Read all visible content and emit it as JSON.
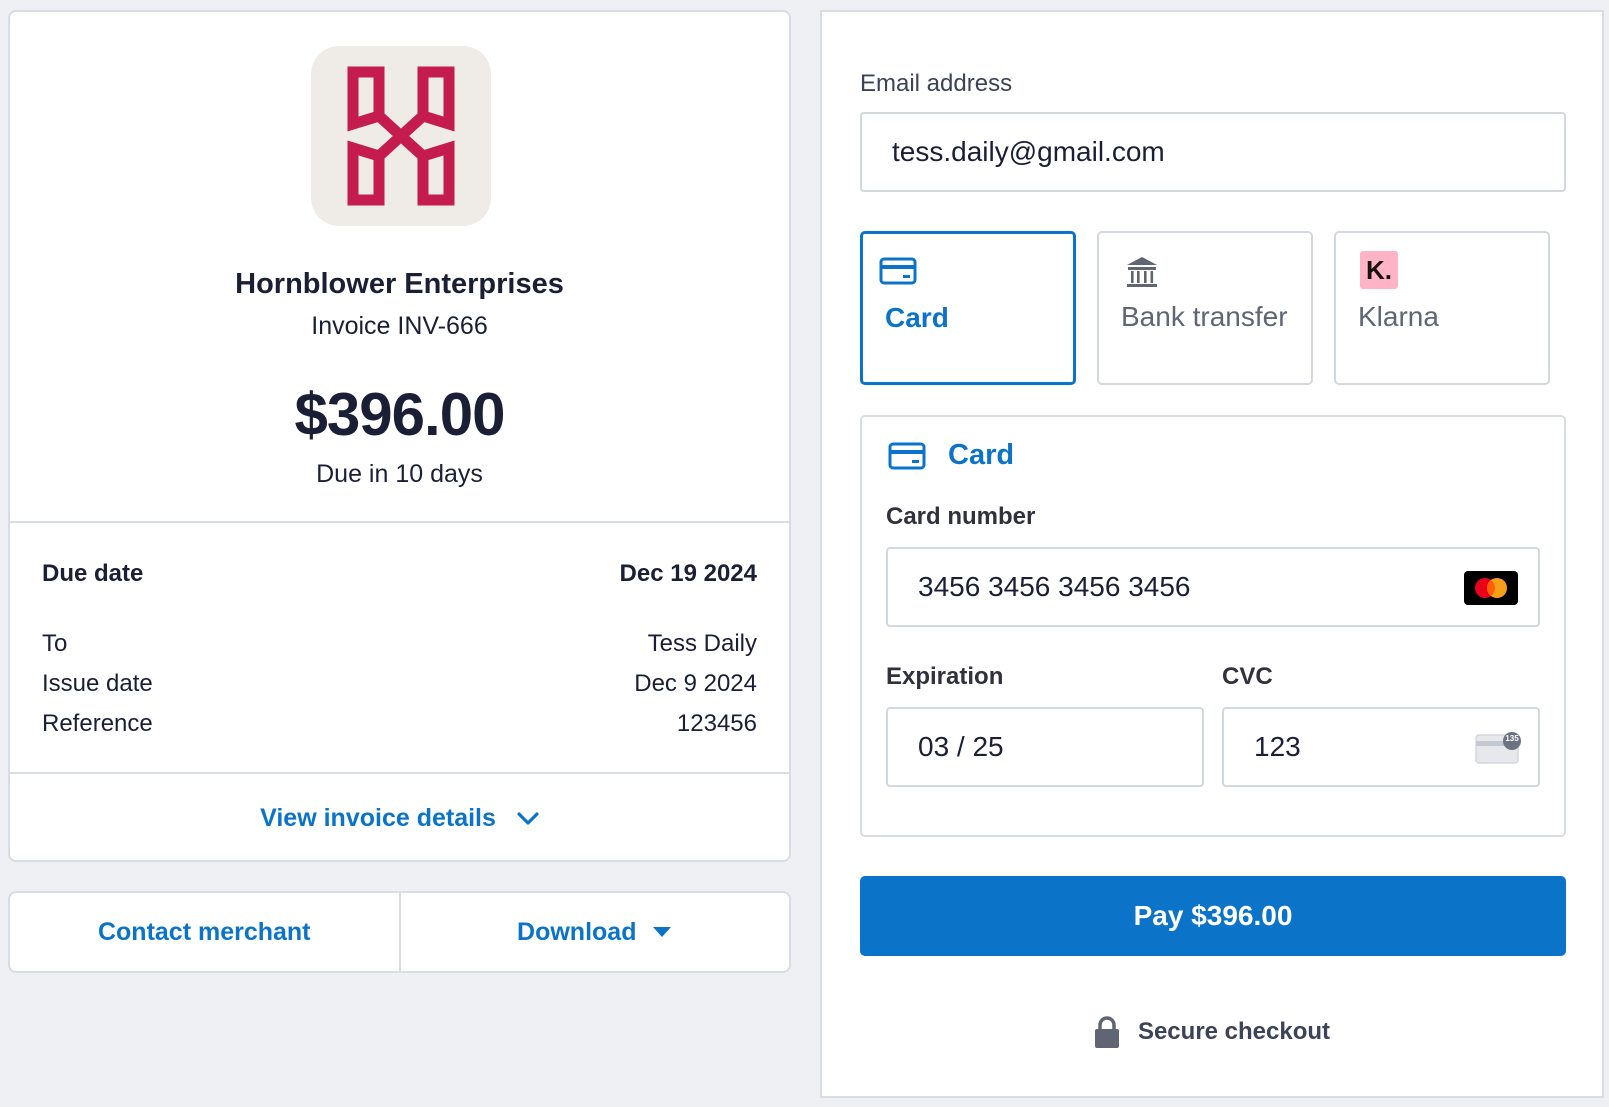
{
  "invoice": {
    "merchant_name": "Hornblower Enterprises",
    "invoice_number": "Invoice INV-666",
    "amount": "$396.00",
    "due_in": "Due in 10 days",
    "due_date_label": "Due date",
    "due_date_value": "Dec 19 2024",
    "details": [
      {
        "label": "To",
        "value": "Tess Daily"
      },
      {
        "label": "Issue date",
        "value": "Dec 9 2024"
      },
      {
        "label": "Reference",
        "value": "123456"
      }
    ],
    "view_details_label": "View invoice details"
  },
  "actions": {
    "contact_label": "Contact merchant",
    "download_label": "Download"
  },
  "checkout": {
    "email_label": "Email address",
    "email_value": "tess.daily@gmail.com",
    "methods": [
      {
        "label": "Card",
        "icon": "card-icon",
        "selected": true
      },
      {
        "label": "Bank transfer",
        "icon": "bank-icon",
        "selected": false
      },
      {
        "label": "Klarna",
        "icon": "klarna-icon",
        "badge": "K.",
        "selected": false
      }
    ],
    "card_section_title": "Card",
    "card_number_label": "Card number",
    "card_number_value": "3456 3456 3456 3456",
    "expiration_label": "Expiration",
    "expiration_value": "03 / 25",
    "cvc_label": "CVC",
    "cvc_value": "123",
    "cvc_hint_badge": "135",
    "pay_label": "Pay $396.00",
    "secure_label": "Secure checkout"
  },
  "colors": {
    "accent": "#0b74c8",
    "logo_red": "#c41c4c",
    "klarna_pink": "#ffb3c7"
  }
}
